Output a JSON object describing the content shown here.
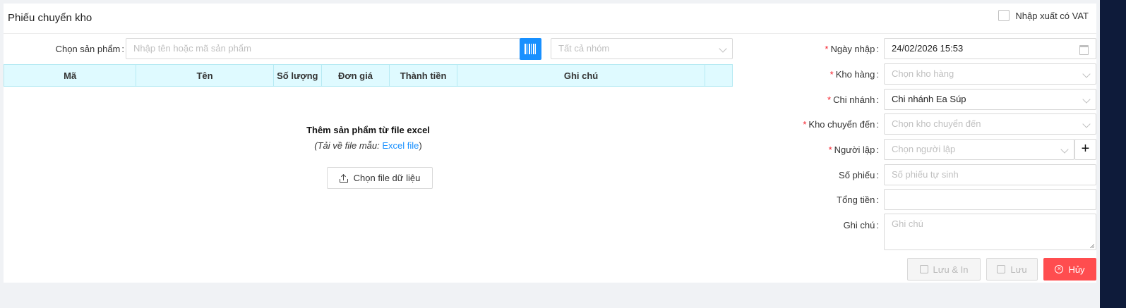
{
  "header": {
    "title": "Phiếu chuyển kho",
    "vat_label": "Nhập xuất có VAT",
    "vat_checked": false
  },
  "product": {
    "label": "Chọn sản phẩm",
    "placeholder": "Nhập tên hoặc mã sản phẩm",
    "group_placeholder": "Tất cả nhóm"
  },
  "table": {
    "columns": [
      "Mã",
      "Tên",
      "Số lượng",
      "Đơn giá",
      "Thành tiền",
      "Ghi chú",
      ""
    ],
    "rows": []
  },
  "excel": {
    "title": "Thêm sản phẩm từ file excel",
    "sub_prefix": "(Tải về file mẫu: ",
    "link": "Excel file",
    "sub_suffix": ")",
    "button": "Chọn file dữ liệu"
  },
  "form": {
    "date": {
      "label": "Ngày nhập",
      "value": "24/02/2026 15:53"
    },
    "warehouse": {
      "label": "Kho hàng",
      "placeholder": "Chọn kho hàng"
    },
    "branch": {
      "label": "Chi nhánh",
      "value": "Chi nhánh Ea Súp"
    },
    "dest_warehouse": {
      "label": "Kho chuyển đến",
      "placeholder": "Chọn kho chuyển đến"
    },
    "creator": {
      "label": "Người lập",
      "placeholder": "Chọn người lập"
    },
    "voucher_no": {
      "label": "Số phiếu",
      "placeholder": "Số phiếu tự sinh"
    },
    "total": {
      "label": "Tổng tiền",
      "value": ""
    },
    "note": {
      "label": "Ghi chú",
      "placeholder": "Ghi chú"
    }
  },
  "buttons": {
    "save_print": "Lưu & In",
    "save": "Lưu",
    "cancel": "Hủy"
  },
  "colors": {
    "primary": "#1890ff",
    "danger": "#ff4d4f",
    "table_header": "#dffaff",
    "required": "#f5222d"
  }
}
